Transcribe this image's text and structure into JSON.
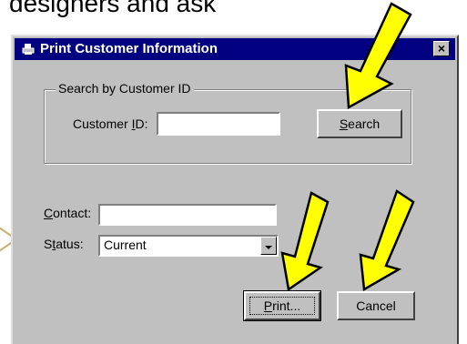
{
  "background_text": "designers and ask",
  "dialog": {
    "title": "Print Customer Information",
    "close_glyph": "×",
    "icon": "printer-icon"
  },
  "search_group": {
    "label": "Search by Customer ID",
    "customer_id": {
      "label_pre": "Customer ",
      "label_key": "I",
      "label_post": "D:",
      "value": ""
    },
    "search_button": {
      "label_key": "S",
      "label_rest": "earch"
    }
  },
  "contact": {
    "label_key": "C",
    "label_rest": "ontact:",
    "value": ""
  },
  "status": {
    "label_pre": "S",
    "label_key": "t",
    "label_post": "atus:",
    "value": "Current"
  },
  "buttons": {
    "print": {
      "label_key": "P",
      "label_rest": "rint..."
    },
    "cancel": {
      "label": "Cancel"
    }
  },
  "colors": {
    "titlebar": "#000080",
    "dialog_bg": "#c0c0c0",
    "annotation_arrow": "#ffff00"
  }
}
